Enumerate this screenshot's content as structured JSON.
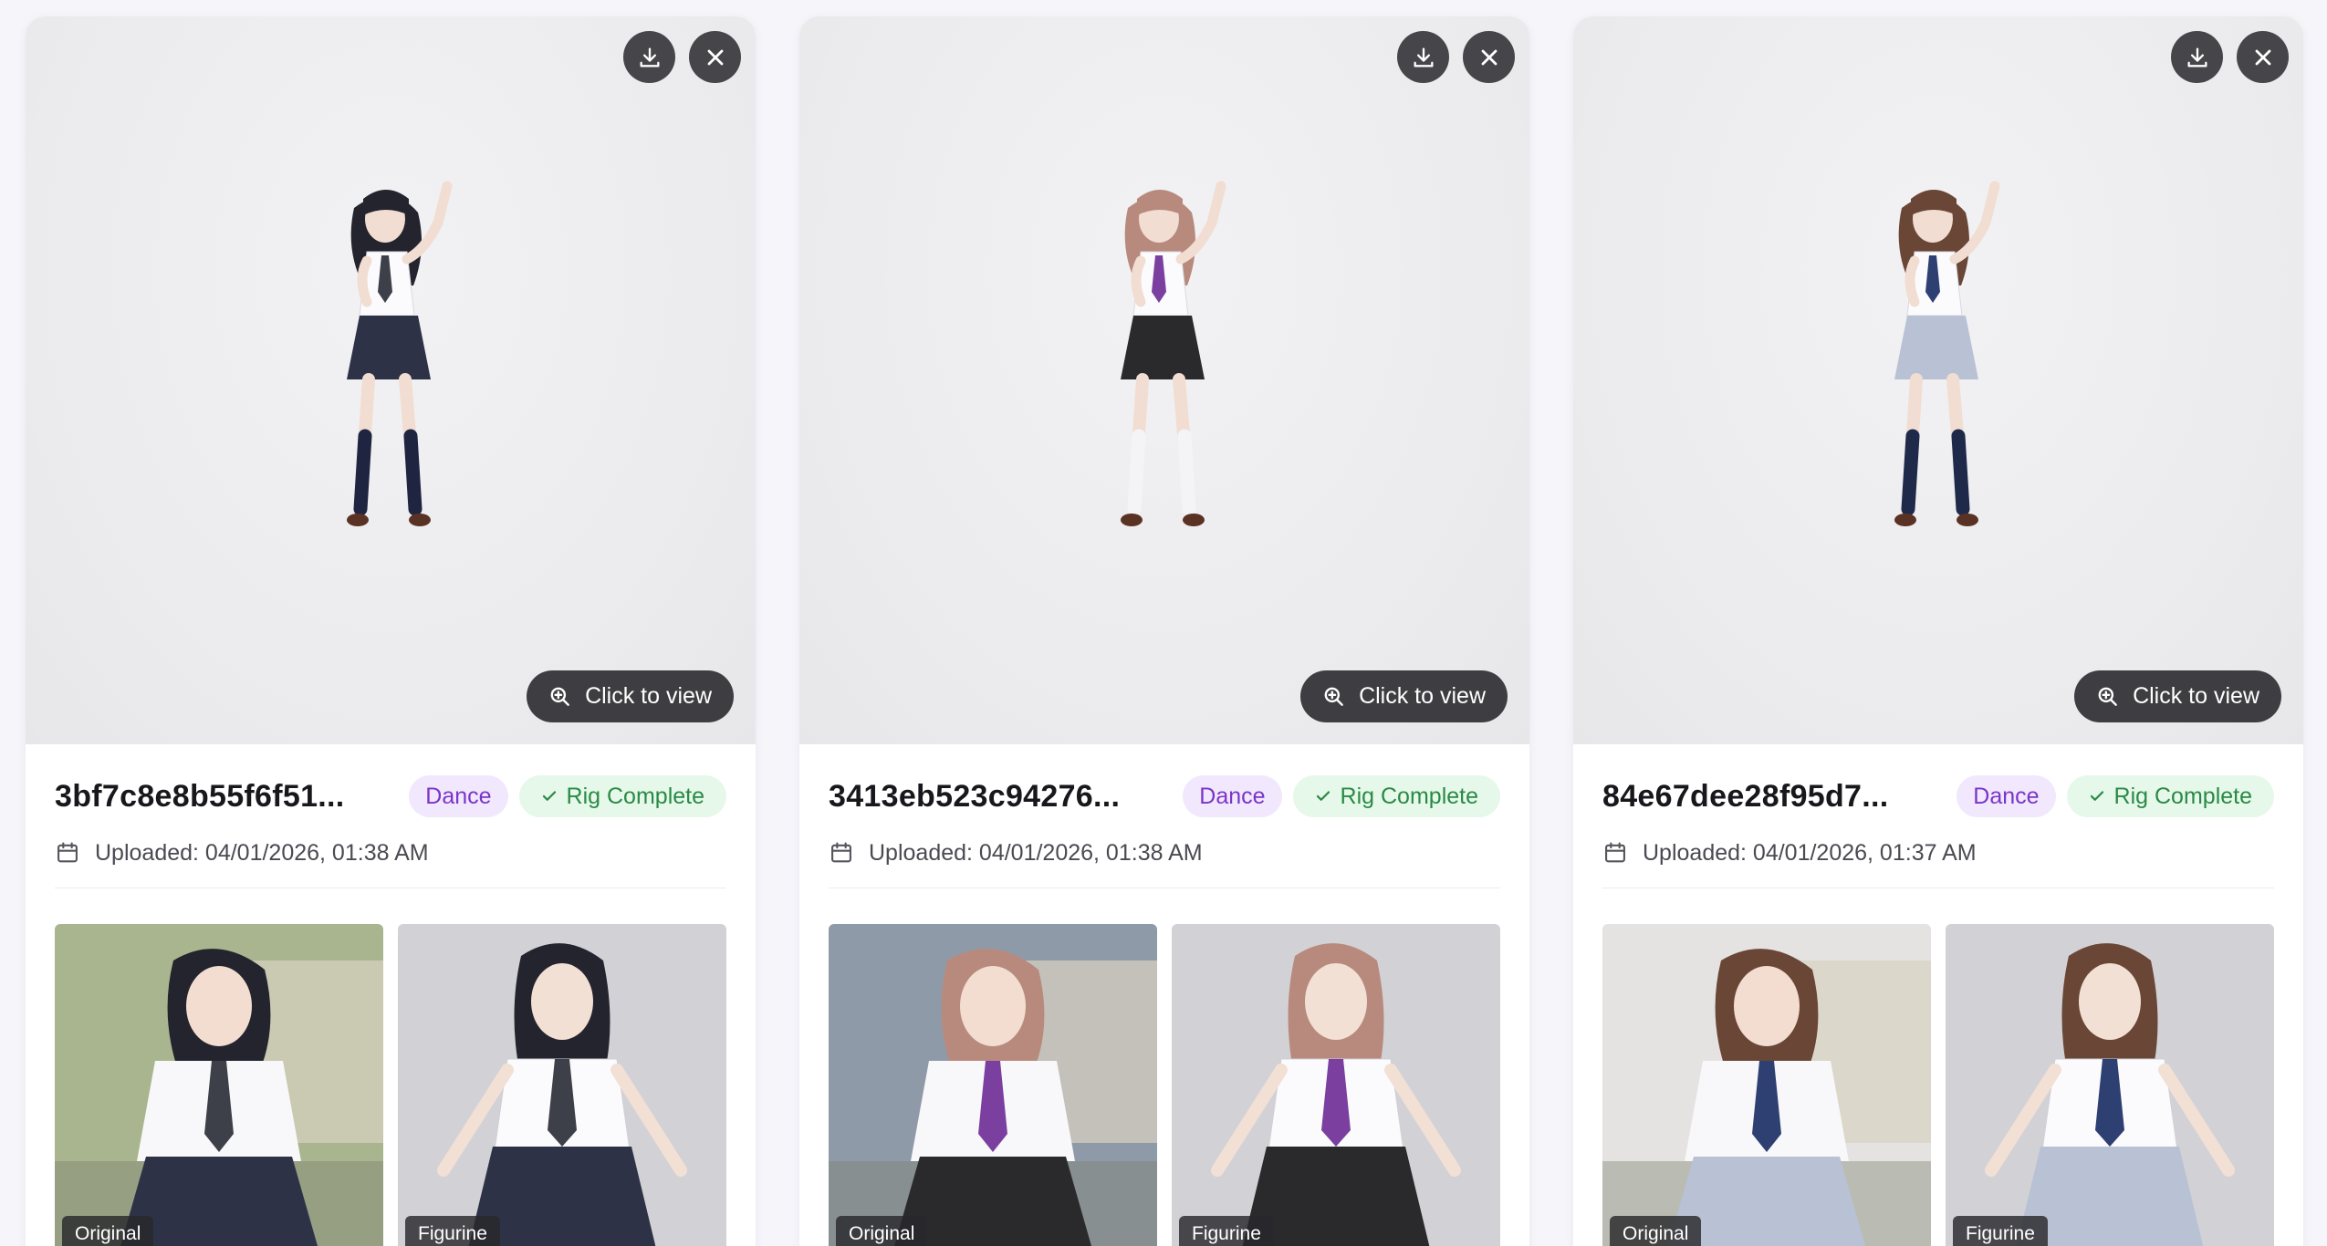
{
  "cards": [
    {
      "id": "3bf7c8e8b55f6f51...",
      "category": "Dance",
      "status": "Rig Complete",
      "uploaded": "Uploaded: 04/01/2026, 01:38 AM",
      "view_label": "Click to view",
      "original_label": "Original",
      "figurine_label": "Figurine",
      "hair_color": "#23242e",
      "skirt_color": "#2e3246",
      "tie_color": "#3d4048",
      "legs_color": "#1f2540"
    },
    {
      "id": "3413eb523c94276...",
      "category": "Dance",
      "status": "Rig Complete",
      "uploaded": "Uploaded: 04/01/2026, 01:38 AM",
      "view_label": "Click to view",
      "original_label": "Original",
      "figurine_label": "Figurine",
      "hair_color": "#b88a7e",
      "skirt_color": "#2a2a2c",
      "tie_color": "#7b3fa0",
      "legs_color": "#f4f4f6"
    },
    {
      "id": "84e67dee28f95d7...",
      "category": "Dance",
      "status": "Rig Complete",
      "uploaded": "Uploaded: 04/01/2026, 01:37 AM",
      "view_label": "Click to view",
      "original_label": "Original",
      "figurine_label": "Figurine",
      "hair_color": "#6a4636",
      "skirt_color": "#b9c2d4",
      "tie_color": "#2e3f72",
      "legs_color": "#1f2a4a"
    }
  ],
  "icons": {
    "download": "download-icon",
    "close": "close-icon",
    "zoom": "zoom-in-icon",
    "check": "check-icon",
    "calendar": "calendar-icon"
  }
}
